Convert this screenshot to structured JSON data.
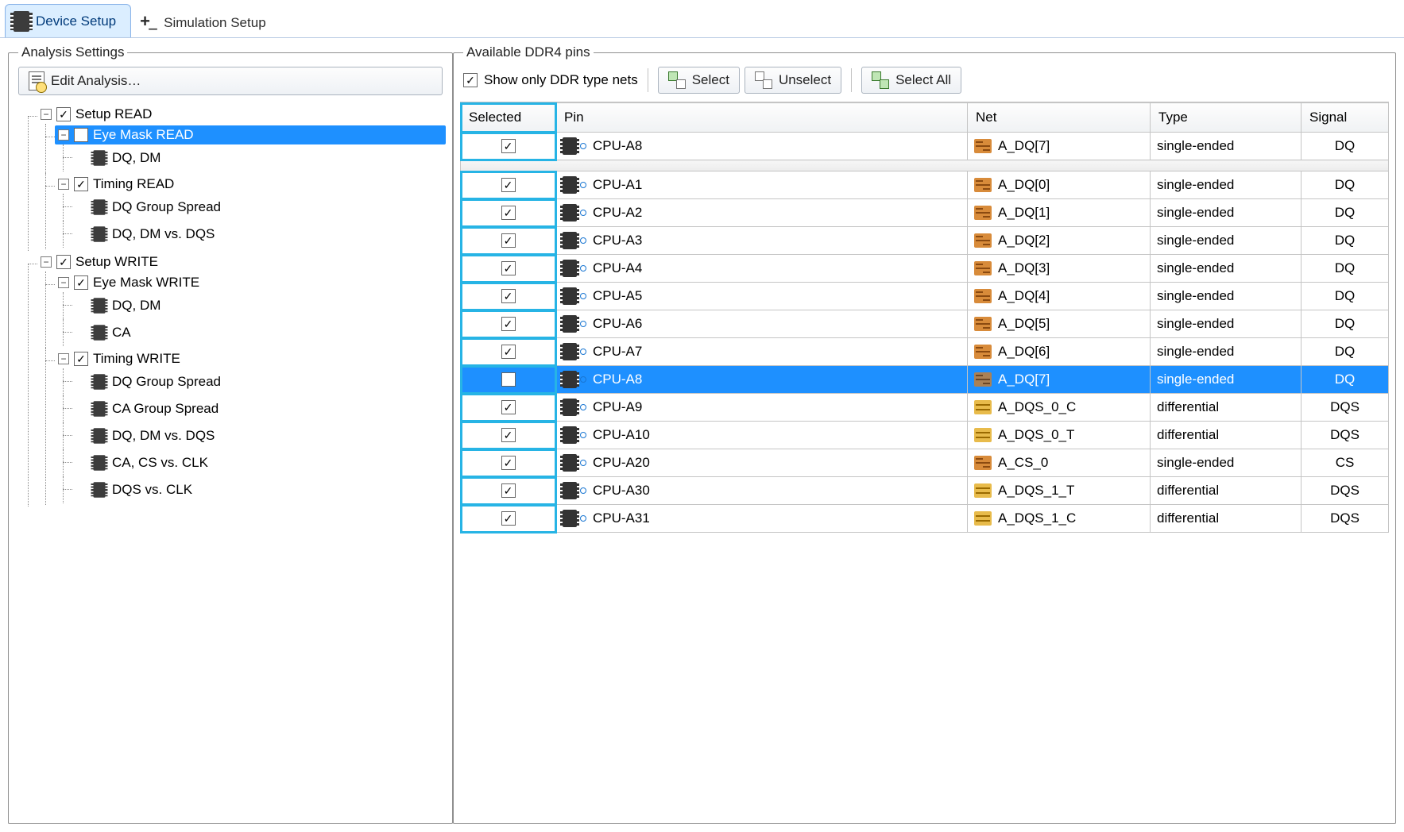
{
  "tabs": {
    "device": "Device Setup",
    "sim": "Simulation Setup"
  },
  "left": {
    "title": "Analysis Settings",
    "editBtn": "Edit Analysis…",
    "tree": [
      {
        "label": "Setup READ",
        "check": true,
        "exp": "-",
        "children": [
          {
            "label": "Eye Mask READ",
            "check": true,
            "exp": "-",
            "selected": true,
            "children": [
              {
                "label": "DQ, DM",
                "leaf": true
              }
            ]
          },
          {
            "label": "Timing READ",
            "check": true,
            "exp": "-",
            "children": [
              {
                "label": "DQ Group Spread",
                "leaf": true
              },
              {
                "label": "DQ, DM vs. DQS",
                "leaf": true
              }
            ]
          }
        ]
      },
      {
        "label": "Setup WRITE",
        "check": true,
        "exp": "-",
        "children": [
          {
            "label": "Eye Mask WRITE",
            "check": true,
            "exp": "-",
            "children": [
              {
                "label": "DQ, DM",
                "leaf": true
              },
              {
                "label": "CA",
                "leaf": true
              }
            ]
          },
          {
            "label": "Timing WRITE",
            "check": true,
            "exp": "-",
            "children": [
              {
                "label": "DQ Group Spread",
                "leaf": true
              },
              {
                "label": "CA Group Spread",
                "leaf": true
              },
              {
                "label": "DQ, DM vs. DQS",
                "leaf": true
              },
              {
                "label": "CA, CS vs. CLK",
                "leaf": true
              },
              {
                "label": "DQS vs. CLK",
                "leaf": true
              }
            ]
          }
        ]
      }
    ]
  },
  "right": {
    "title": "Available DDR4 pins",
    "showOnly": "Show only DDR type nets",
    "showOnlyChecked": true,
    "btnSelect": "Select",
    "btnUnselect": "Unselect",
    "btnSelectAll": "Select All",
    "cols": {
      "selected": "Selected",
      "pin": "Pin",
      "net": "Net",
      "type": "Type",
      "signal": "Signal"
    },
    "topRow": {
      "selected": true,
      "pin": "CPU-A8",
      "net": "A_DQ[7]",
      "netKind": "single",
      "type": "single-ended",
      "signal": "DQ"
    },
    "rows": [
      {
        "selected": true,
        "pin": "CPU-A1",
        "net": "A_DQ[0]",
        "netKind": "single",
        "type": "single-ended",
        "signal": "DQ"
      },
      {
        "selected": true,
        "pin": "CPU-A2",
        "net": "A_DQ[1]",
        "netKind": "single",
        "type": "single-ended",
        "signal": "DQ"
      },
      {
        "selected": true,
        "pin": "CPU-A3",
        "net": "A_DQ[2]",
        "netKind": "single",
        "type": "single-ended",
        "signal": "DQ"
      },
      {
        "selected": true,
        "pin": "CPU-A4",
        "net": "A_DQ[3]",
        "netKind": "single",
        "type": "single-ended",
        "signal": "DQ"
      },
      {
        "selected": true,
        "pin": "CPU-A5",
        "net": "A_DQ[4]",
        "netKind": "single",
        "type": "single-ended",
        "signal": "DQ"
      },
      {
        "selected": true,
        "pin": "CPU-A6",
        "net": "A_DQ[5]",
        "netKind": "single",
        "type": "single-ended",
        "signal": "DQ"
      },
      {
        "selected": true,
        "pin": "CPU-A7",
        "net": "A_DQ[6]",
        "netKind": "single",
        "type": "single-ended",
        "signal": "DQ"
      },
      {
        "selected": true,
        "pin": "CPU-A8",
        "net": "A_DQ[7]",
        "netKind": "single",
        "type": "single-ended",
        "signal": "DQ",
        "highlight": true
      },
      {
        "selected": true,
        "pin": "CPU-A9",
        "net": "A_DQS_0_C",
        "netKind": "diff",
        "type": "differential",
        "signal": "DQS"
      },
      {
        "selected": true,
        "pin": "CPU-A10",
        "net": "A_DQS_0_T",
        "netKind": "diff",
        "type": "differential",
        "signal": "DQS"
      },
      {
        "selected": true,
        "pin": "CPU-A20",
        "net": "A_CS_0",
        "netKind": "single",
        "type": "single-ended",
        "signal": "CS"
      },
      {
        "selected": true,
        "pin": "CPU-A30",
        "net": "A_DQS_1_T",
        "netKind": "diff",
        "type": "differential",
        "signal": "DQS"
      },
      {
        "selected": true,
        "pin": "CPU-A31",
        "net": "A_DQS_1_C",
        "netKind": "diff",
        "type": "differential",
        "signal": "DQS"
      }
    ]
  }
}
